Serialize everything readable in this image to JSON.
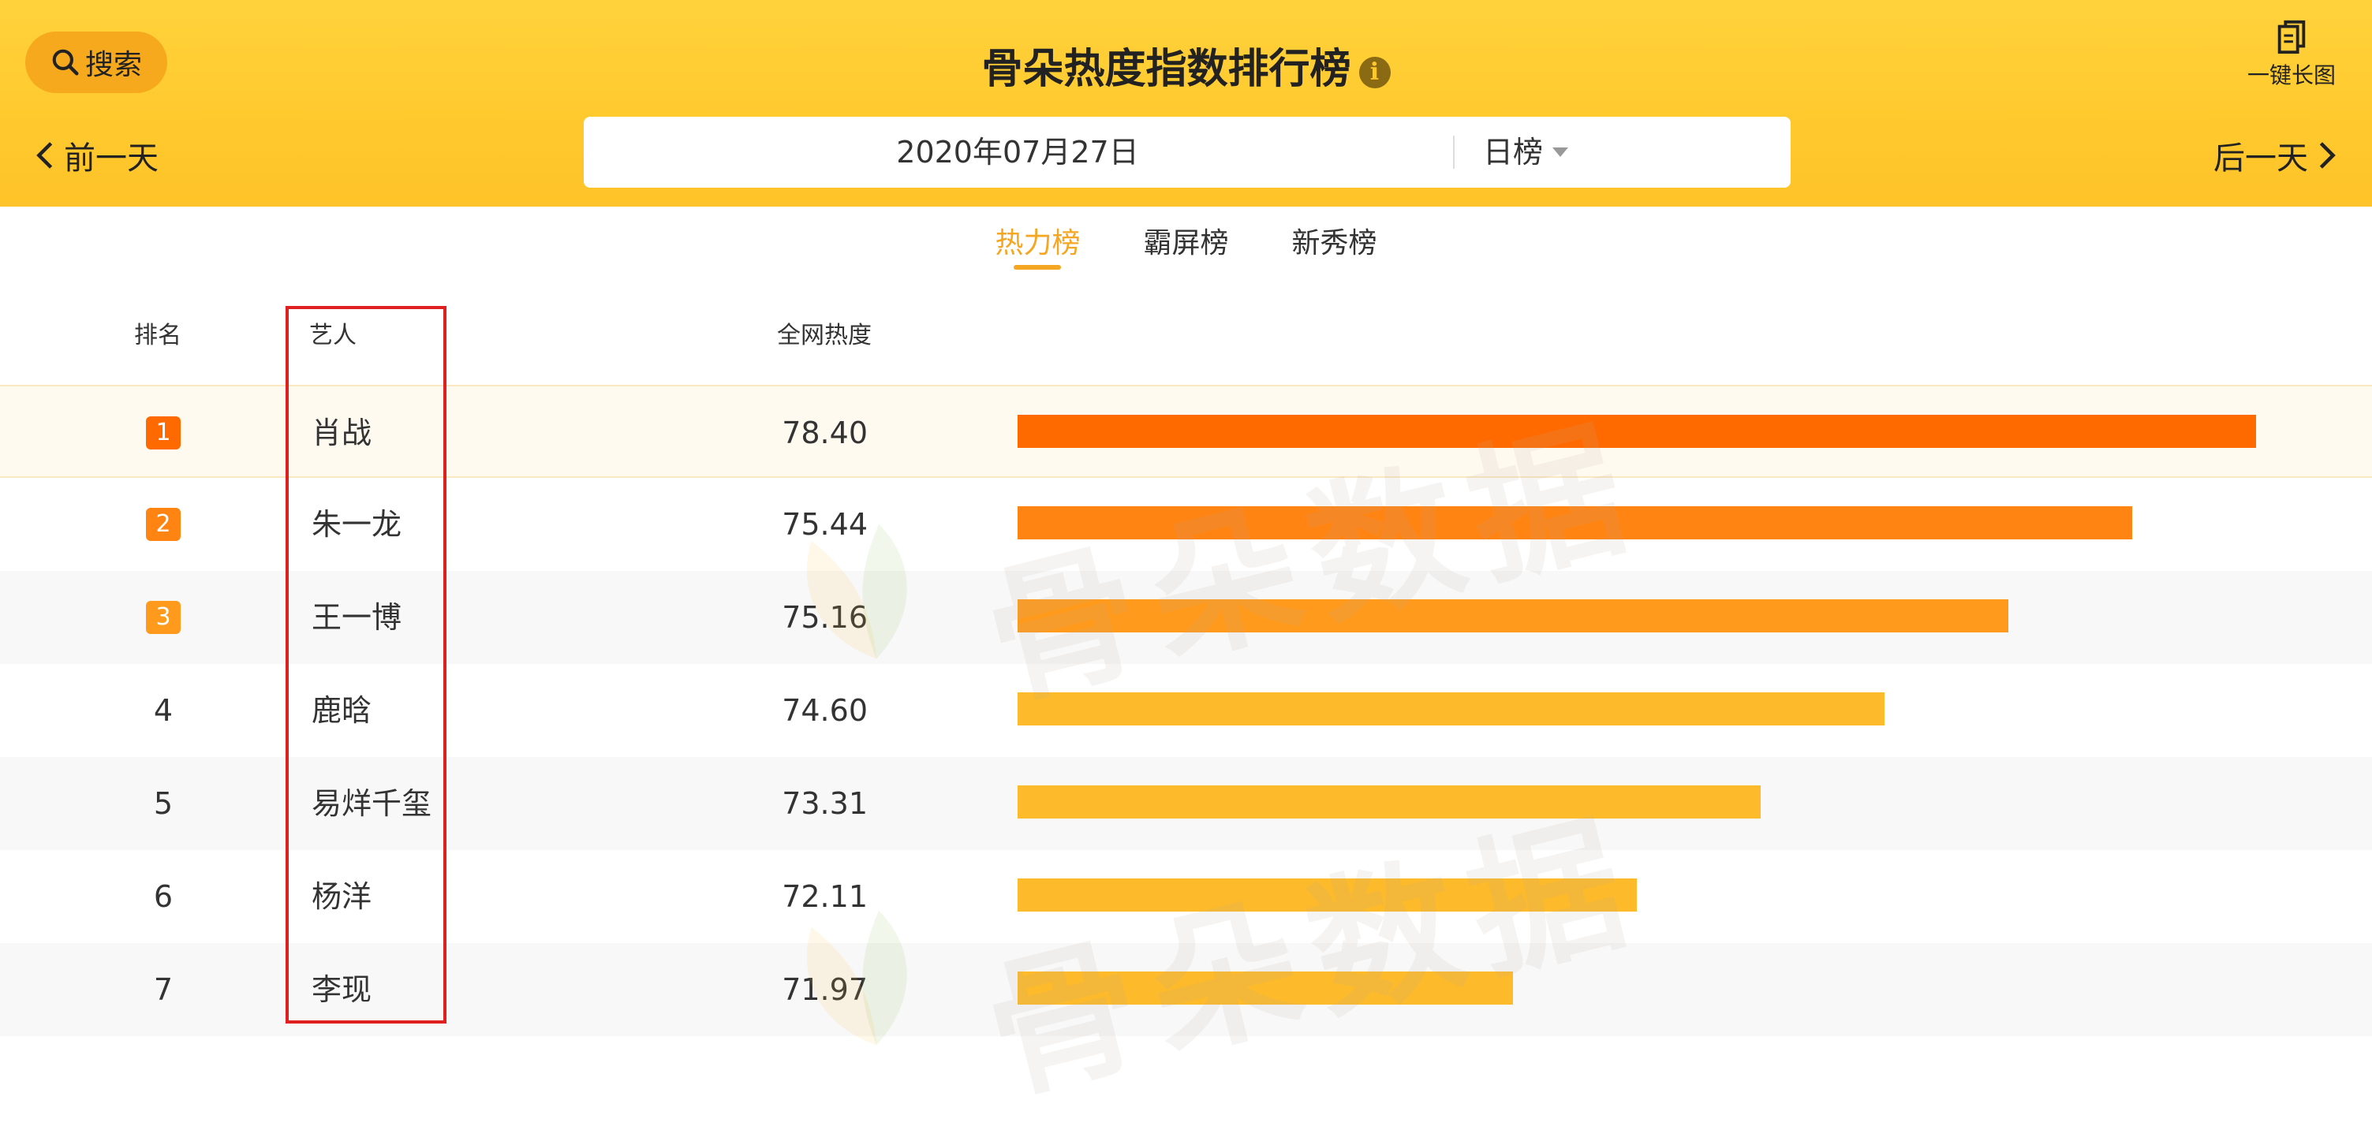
{
  "header": {
    "search_label": "搜索",
    "title": "骨朵热度指数排行榜",
    "long_image_label": "一键长图",
    "prev_day_label": "前一天",
    "next_day_label": "后一天",
    "date": "2020年07月27日",
    "list_type": "日榜"
  },
  "tabs": [
    {
      "label": "热力榜",
      "active": true
    },
    {
      "label": "霸屏榜",
      "active": false
    },
    {
      "label": "新秀榜",
      "active": false
    }
  ],
  "table": {
    "columns": {
      "rank": "排名",
      "artist": "艺人",
      "heat": "全网热度"
    },
    "rows": [
      {
        "rank": "1",
        "artist": "肖战",
        "heat": "78.40",
        "bar_fill": 1.0,
        "color": "#ff6a00"
      },
      {
        "rank": "2",
        "artist": "朱一龙",
        "heat": "75.44",
        "bar_fill": 0.9,
        "color": "#ff8412"
      },
      {
        "rank": "3",
        "artist": "王一博",
        "heat": "75.16",
        "bar_fill": 0.8,
        "color": "#ff9a1c"
      },
      {
        "rank": "4",
        "artist": "鹿晗",
        "heat": "74.60",
        "bar_fill": 0.7,
        "color": "#fdbb2b"
      },
      {
        "rank": "5",
        "artist": "易烊千玺",
        "heat": "73.31",
        "bar_fill": 0.6,
        "color": "#fdbb2b"
      },
      {
        "rank": "6",
        "artist": "杨洋",
        "heat": "72.11",
        "bar_fill": 0.5,
        "color": "#fdbb2b"
      },
      {
        "rank": "7",
        "artist": "李现",
        "heat": "71.97",
        "bar_fill": 0.4,
        "color": "#fdbb2b"
      }
    ]
  },
  "watermark": {
    "text": "骨朵数据"
  },
  "colors": {
    "header_bg": "#ffc92d",
    "search_btn": "#f7a91d",
    "active_tab": "#f5a623",
    "highlight_row": "#fffaf0",
    "alt_row": "#f8f8f8",
    "annotation_box": "#e02020"
  }
}
